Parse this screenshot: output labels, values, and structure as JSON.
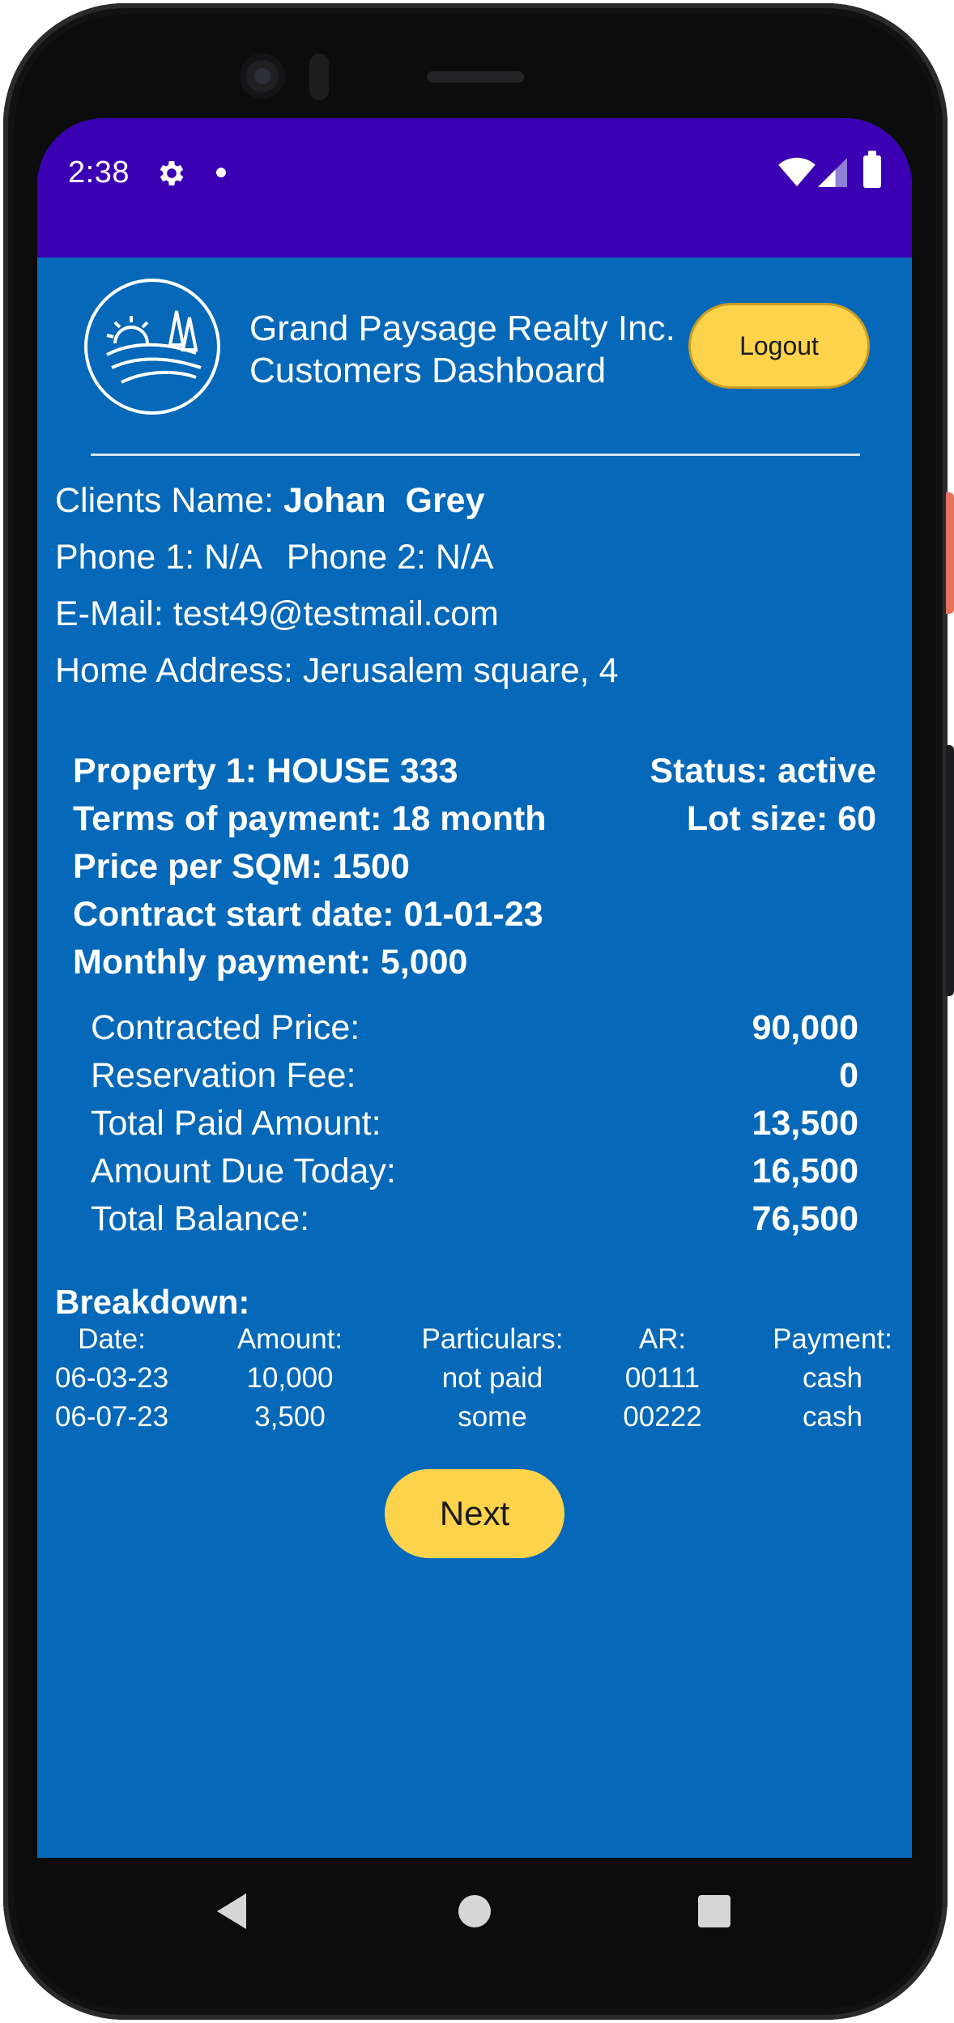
{
  "status_bar": {
    "time": "2:38"
  },
  "header": {
    "company_line1": "Grand Paysage Realty Inc.",
    "company_line2": "Customers Dashboard",
    "logout_label": "Logout"
  },
  "client": {
    "name_label": "Clients Name:",
    "name_value": "Johan  Grey",
    "phone1_label": "Phone 1:",
    "phone1_value": "N/A",
    "phone2_label": "Phone 2:",
    "phone2_value": "N/A",
    "email_label": "E-Mail:",
    "email_value": "test49@testmail.com",
    "address_label": "Home Address:",
    "address_value": "Jerusalem square, 4"
  },
  "property": {
    "title": "Property 1: HOUSE 333",
    "status": "Status: active",
    "terms": "Terms of payment: 18 month",
    "lot_size": "Lot size: 60",
    "price_per_sqm": "Price per SQM: 1500",
    "contract_start": "Contract start date: 01-01-23",
    "monthly_payment": "Monthly payment: 5,000"
  },
  "summary": [
    {
      "label": "Contracted Price:",
      "value": "90,000"
    },
    {
      "label": "Reservation Fee:",
      "value": "0"
    },
    {
      "label": "Total Paid Amount:",
      "value": "13,500"
    },
    {
      "label": "Amount Due Today:",
      "value": "16,500"
    },
    {
      "label": "Total Balance:",
      "value": "76,500"
    }
  ],
  "breakdown": {
    "title": "Breakdown:",
    "headers": [
      "Date:",
      "Amount:",
      "Particulars:",
      "AR:",
      "Payment:"
    ],
    "rows": [
      [
        "06-03-23",
        "10,000",
        "not paid",
        "00111",
        "cash"
      ],
      [
        "06-07-23",
        "3,500",
        "some",
        "00222",
        "cash"
      ]
    ]
  },
  "next_label": "Next",
  "colors": {
    "status_bar": "#3b00b3",
    "background": "#0568b8",
    "accent_button": "#fdd34c"
  }
}
